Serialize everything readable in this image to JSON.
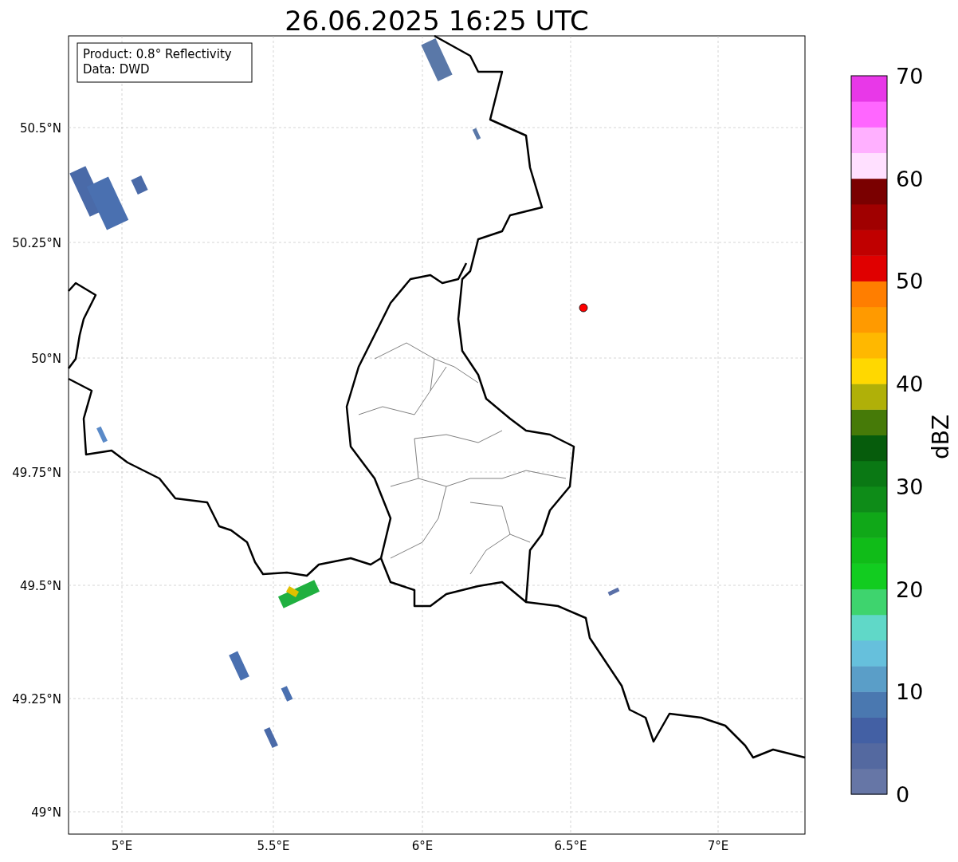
{
  "title": "26.06.2025 16:25 UTC",
  "info_box": [
    "Product: 0.8° Reflectivity",
    "Data: DWD"
  ],
  "y_ticks": [
    "50.5°N",
    "50.25°N",
    "50°N",
    "49.75°N",
    "49.5°N",
    "49.25°N",
    "49°N"
  ],
  "x_ticks": [
    "5°E",
    "5.5°E",
    "6°E",
    "6.5°E",
    "7°E"
  ],
  "colorbar": {
    "label": "dBZ",
    "ticks": [
      "70",
      "60",
      "50",
      "40",
      "30",
      "20",
      "10",
      "0"
    ],
    "bins": [
      {
        "color": "#6676a6"
      },
      {
        "color": "#5469a0"
      },
      {
        "color": "#4360a4"
      },
      {
        "color": "#4a78b0"
      },
      {
        "color": "#5a9ec8"
      },
      {
        "color": "#66c0dc"
      },
      {
        "color": "#60d8c8"
      },
      {
        "color": "#3ed46e"
      },
      {
        "color": "#12cc20"
      },
      {
        "color": "#10bc18"
      },
      {
        "color": "#10a818"
      },
      {
        "color": "#0e8c18"
      },
      {
        "color": "#0a7814"
      },
      {
        "color": "#065c0c"
      },
      {
        "color": "#467a08"
      },
      {
        "color": "#b0b008"
      },
      {
        "color": "#ffd800"
      },
      {
        "color": "#ffb800"
      },
      {
        "color": "#ff9a00"
      },
      {
        "color": "#ff7e00"
      },
      {
        "color": "#e00000"
      },
      {
        "color": "#c00000"
      },
      {
        "color": "#a00000"
      },
      {
        "color": "#7a0000"
      },
      {
        "color": "#ffe0ff"
      },
      {
        "color": "#ffb0ff"
      },
      {
        "color": "#ff66ff"
      },
      {
        "color": "#e838e8"
      }
    ]
  }
}
